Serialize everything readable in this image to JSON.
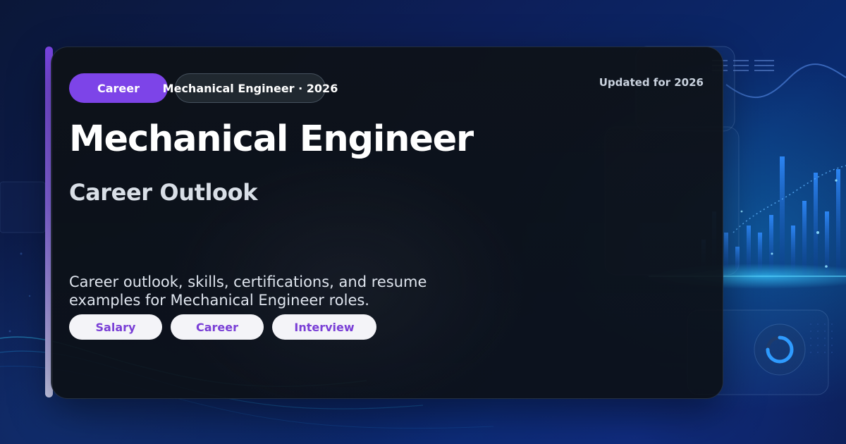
{
  "badge": {
    "primary": "Career",
    "secondary": "Mechanical Engineer · 2026"
  },
  "updated": "Updated for 2026",
  "title": "Mechanical Engineer",
  "subtitle": "Career Outlook",
  "description": "Career outlook, skills, certifications, and resume examples for Mechanical Engineer roles.",
  "tags": [
    "Salary",
    "Career",
    "Interview"
  ],
  "colors": {
    "accent": "#7d44e8",
    "tag_text": "#7a3fd6",
    "card_bg": "#0e1218",
    "page_bg": "#0d1f5a"
  },
  "icons": [
    "circle-progress-icon"
  ]
}
